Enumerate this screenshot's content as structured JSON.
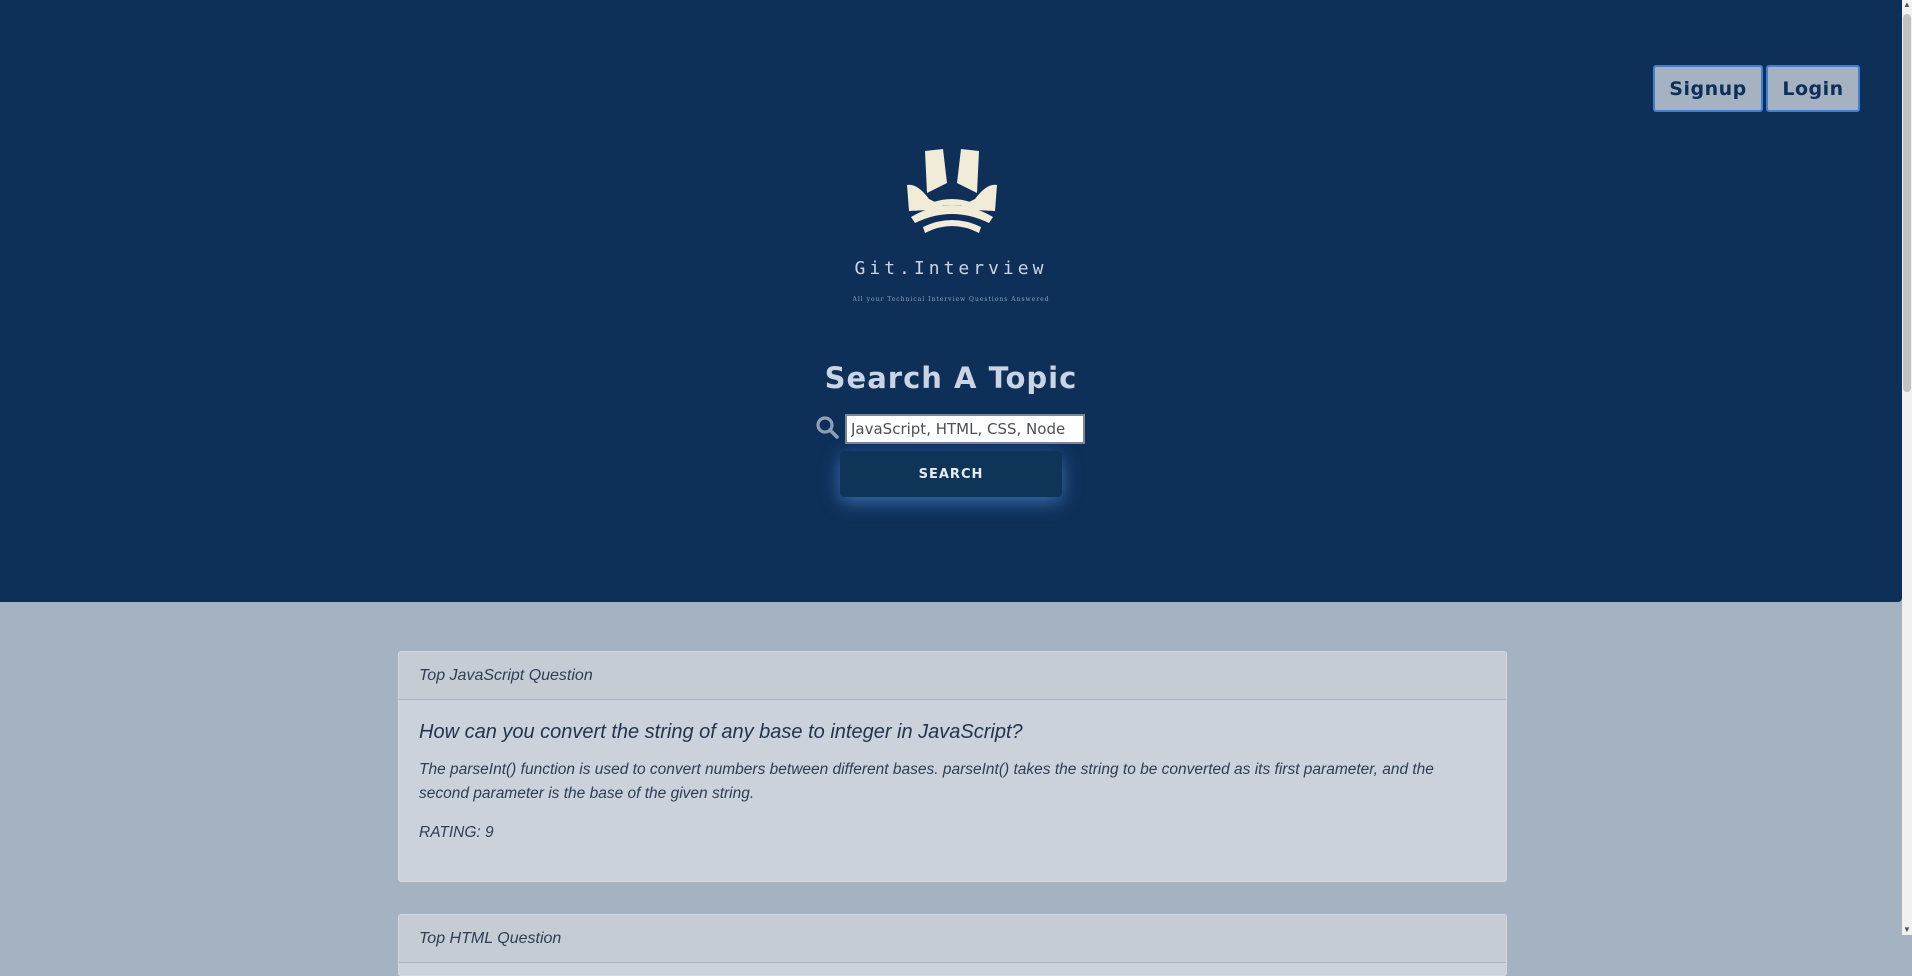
{
  "auth": {
    "signup_label": "Signup",
    "login_label": "Login"
  },
  "brand": {
    "logo_icon": "tri-arc-logo-icon",
    "name": "Git.Interview",
    "tagline": "All your Technical Interview Questions Answered"
  },
  "search": {
    "heading": "Search A Topic",
    "icon": "search-icon",
    "placeholder": "JavaScript, HTML, CSS, Node",
    "button_label": "SEARCH"
  },
  "cards": [
    {
      "header": "Top JavaScript Question",
      "question": "How can you convert the string of any base to integer in JavaScript?",
      "answer": "The parseInt() function is used to convert numbers between different bases. parseInt() takes the string to be converted as its first parameter, and the second parameter is the base of the given string.",
      "rating": "RATING: 9"
    },
    {
      "header": "Top HTML Question"
    }
  ],
  "colors": {
    "hero_bg": "#0e2f58",
    "page_bg": "#a5b2c1",
    "logo": "#f0ecd8",
    "button_border": "#3f7fd4"
  }
}
